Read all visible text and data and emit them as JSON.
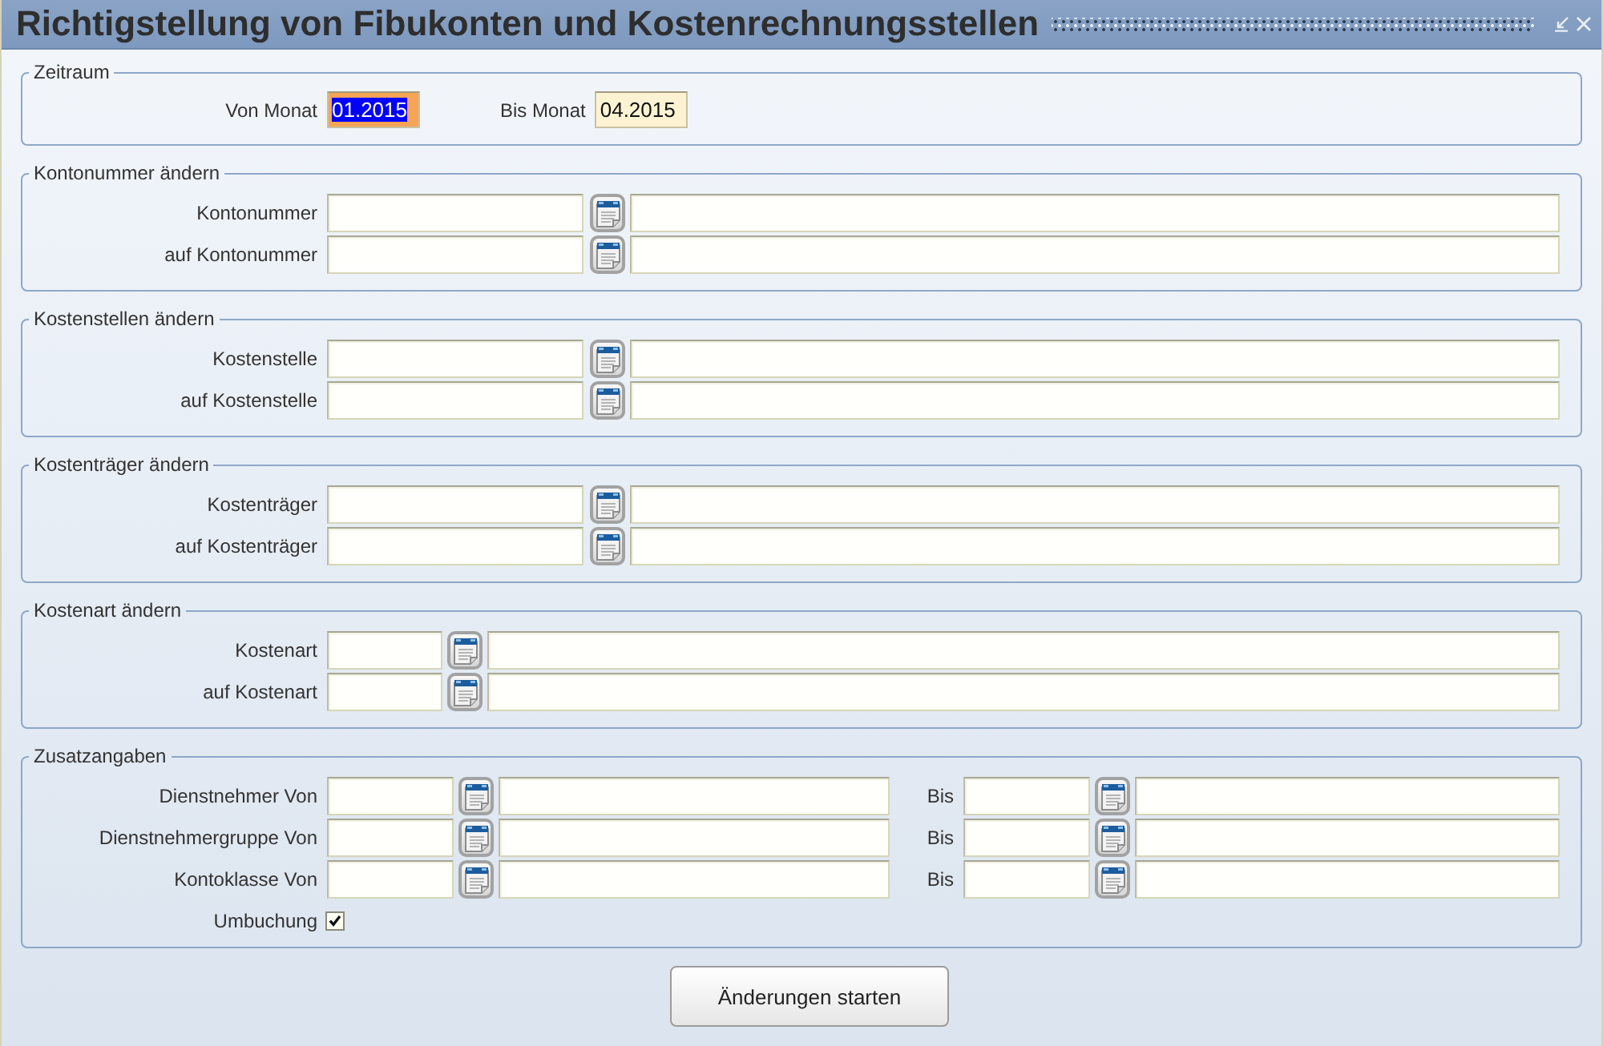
{
  "window": {
    "title": "Richtigstellung von Fibukonten und Kostenrechnungsstellen"
  },
  "zeitraum": {
    "legend": "Zeitraum",
    "fields": [
      {
        "label": "Von Monat",
        "value": "01.2015",
        "focused": true
      },
      {
        "label": "Bis Monat",
        "value": "04.2015",
        "focused": false
      }
    ]
  },
  "groups": [
    {
      "legend": "Kontonummer ändern",
      "kind": "long",
      "rows": [
        {
          "label": "Kontonummer"
        },
        {
          "label": "auf Kontonummer"
        }
      ]
    },
    {
      "legend": "Kostenstellen ändern",
      "kind": "long",
      "rows": [
        {
          "label": "Kostenstelle"
        },
        {
          "label": "auf Kostenstelle"
        }
      ]
    },
    {
      "legend": "Kostenträger ändern",
      "kind": "long",
      "rows": [
        {
          "label": "Kostenträger"
        },
        {
          "label": "auf Kostenträger"
        }
      ]
    },
    {
      "legend": "Kostenart ändern",
      "kind": "short",
      "rows": [
        {
          "label": "Kostenart"
        },
        {
          "label": "auf Kostenart"
        }
      ]
    }
  ],
  "zusatzangaben": {
    "legend": "Zusatzangaben",
    "rows": [
      {
        "label": "Dienstnehmer Von",
        "to_label": "Bis"
      },
      {
        "label": "Dienstnehmergruppe Von",
        "to_label": "Bis"
      },
      {
        "label": "Kontoklasse Von",
        "to_label": "Bis"
      }
    ],
    "checkbox": {
      "label": "Umbuchung",
      "checked": true
    }
  },
  "button": {
    "label": "Änderungen starten"
  }
}
